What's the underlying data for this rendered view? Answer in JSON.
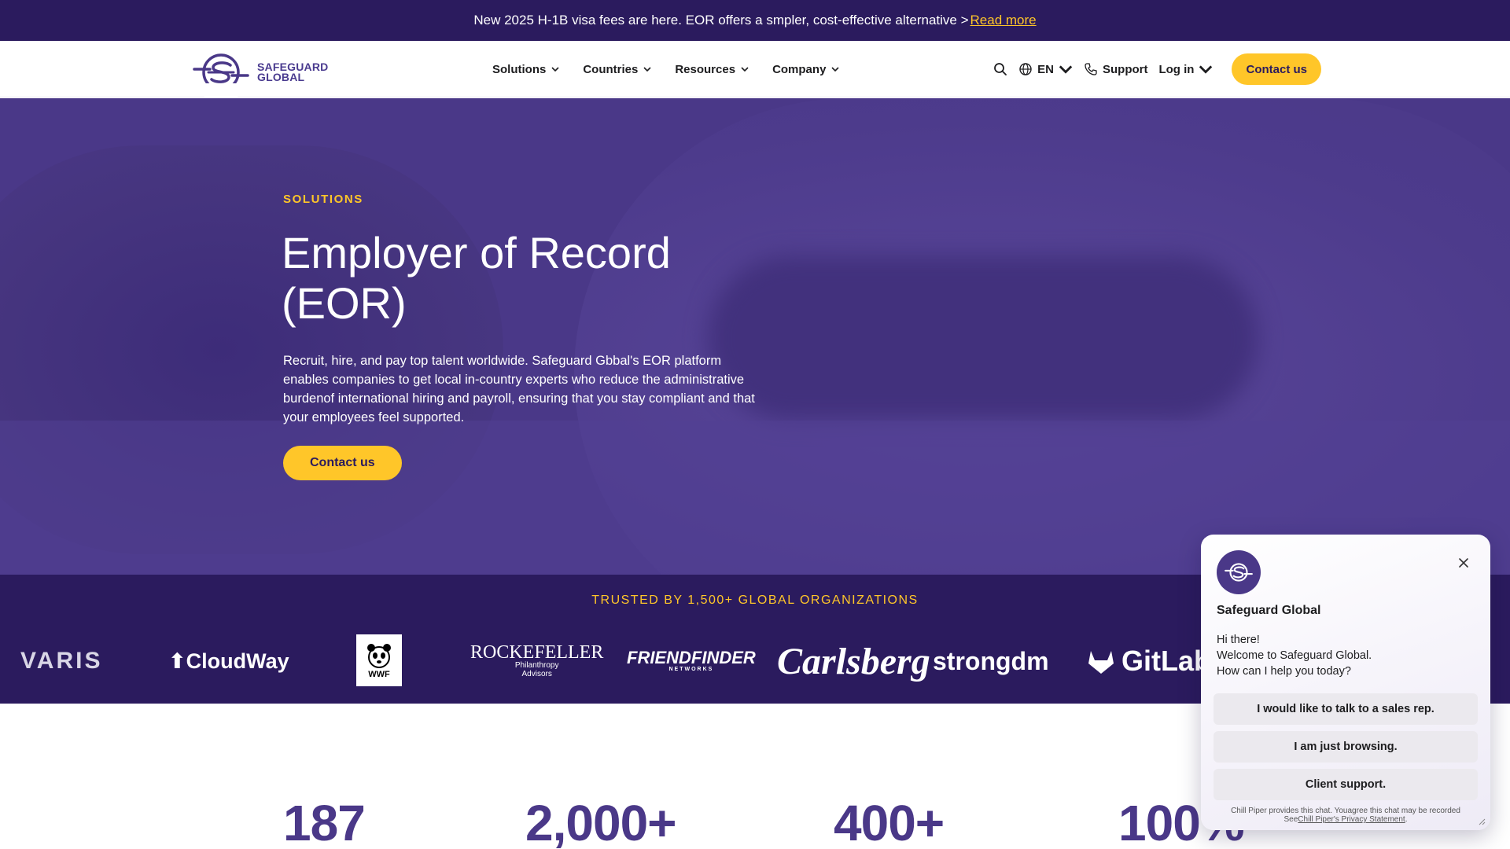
{
  "announcement": {
    "text": "New 2025 H-1B visa fees are here. EOR offers a smpler, cost-effective alternative >",
    "link": "Read more"
  },
  "brand": {
    "line1": "SAFEGUARD",
    "line2": "GLOBAL",
    "primary": "#4a3888",
    "accent": "#ffc629",
    "dark": "#2b1b5e"
  },
  "nav": {
    "items": [
      {
        "label": "Solutions"
      },
      {
        "label": "Countries"
      },
      {
        "label": "Resources"
      },
      {
        "label": "Company"
      }
    ],
    "search_icon": "search-icon",
    "language": "EN",
    "support": "Support",
    "login": "Log in",
    "contact": "Contact us"
  },
  "hero": {
    "eyebrow": "SOLUTIONS",
    "title_line1": "Employer of Record",
    "title_line2": "(EOR)",
    "body": "Recruit, hire, and pay top talent worldwide. Safeguard Gbbal's EOR platform enables companies to get local in-country experts who reduce the administrative burdenof international hiring and payroll, ensuring that you stay compliant and that your employees feel supported.",
    "cta": "Contact us"
  },
  "trusted": {
    "title": "TRUSTED BY 1,500+ GLOBAL ORGANIZATIONS",
    "logos": {
      "varis": "VARIS",
      "cloudway": "CloudWay",
      "wwf": "WWF",
      "rockefeller": "ROCKEFELLER",
      "rockefeller_sub1": "Philanthropy",
      "rockefeller_sub2": "Advisors",
      "friendfinder": "FRIENDFINDER",
      "friendfinder_sub": "NETWORKS",
      "carlsberg": "Carlsberg",
      "strongdm": "strongdm",
      "gitlab": "GitLab"
    }
  },
  "stats": [
    "187",
    "2,000+",
    "400+",
    "100%"
  ],
  "chat": {
    "name": "Safeguard Global",
    "greeting": "Hi there!",
    "welcome": "Welcome to Safeguard Global.",
    "question": "How can I help you today?",
    "options": [
      "I would like to talk to a sales rep.",
      "I am just browsing.",
      "Client support."
    ],
    "footer_text": "Chill Piper provides this chat. Youagree this chat may be recorded",
    "footer_see": "See",
    "footer_link": "Chill Piper's Privacy Statement",
    "footer_end": "."
  }
}
